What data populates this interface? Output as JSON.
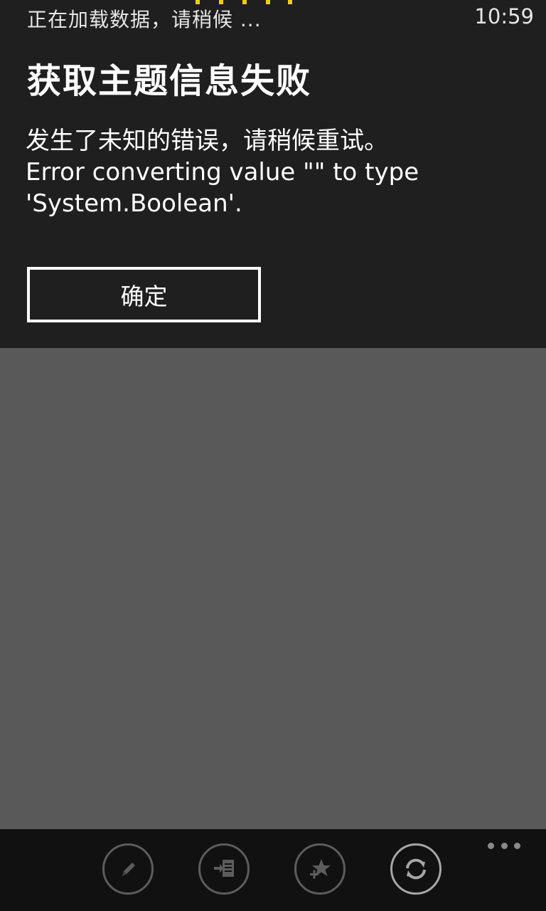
{
  "status_bar": {
    "loading_text": "正在加载数据，请稍候 ...",
    "time": "10:59"
  },
  "dialog": {
    "title": "获取主题信息失败",
    "message_line1": "发生了未知的错误，请稍候重试。",
    "message_line2": "Error converting value \"\" to type",
    "message_line3": "'System.Boolean'.",
    "ok_label": "确定"
  },
  "app_bar": {
    "buttons": [
      {
        "icon": "edit-icon"
      },
      {
        "icon": "import-list-icon"
      },
      {
        "icon": "add-favorite-icon"
      },
      {
        "icon": "refresh-icon"
      }
    ],
    "more_icon": "more-dots-icon"
  },
  "colors": {
    "dialog_bg": "#1f1f1f",
    "overlay_bg": "#595959",
    "app_bar_bg": "#111111",
    "progress_accent": "#f0d000",
    "text": "#ffffff"
  }
}
